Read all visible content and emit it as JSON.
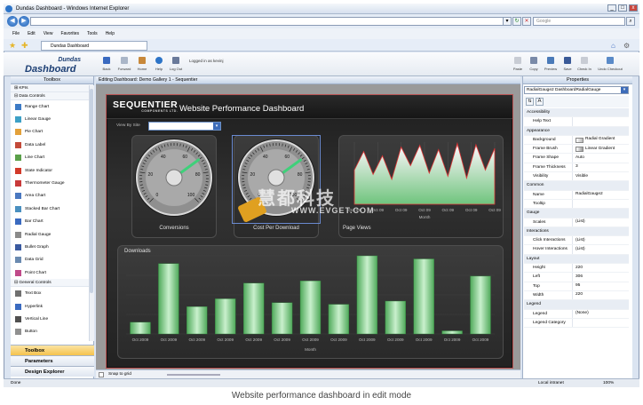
{
  "window": {
    "title": "Dundas Dashboard - Windows Internet Explorer",
    "buttons": [
      "_",
      "□",
      "x"
    ]
  },
  "browser": {
    "search_placeholder": "Google",
    "menu": [
      "File",
      "Edit",
      "View",
      "Favorites",
      "Tools",
      "Help"
    ],
    "fav_tab": "Dundas Dashboard",
    "status_left": "Done",
    "status_zone": "Local intranet",
    "zoom": "100%"
  },
  "app": {
    "logo_top": "Dundas",
    "logo_bottom": "Dashboard",
    "toolbar_left": [
      "Back",
      "Forward",
      "Home",
      "Help",
      "Log Out"
    ],
    "login_text": "Logged in as kevinj",
    "toolbar_right": [
      "Paste",
      "Copy",
      "Preview",
      "Save",
      "Check In",
      "Undo Checkout"
    ]
  },
  "toolbox": {
    "header": "Toolbox",
    "items": [
      {
        "kind": "cat",
        "label": "KPIs",
        "icon": "expand-icon"
      },
      {
        "kind": "cat",
        "label": "Data Controls",
        "icon": "collapse-icon"
      },
      {
        "kind": "item",
        "label": "Range Chart",
        "icon": "range-chart-icon",
        "color": "#3d7bc6"
      },
      {
        "kind": "item",
        "label": "Linear Gauge",
        "icon": "linear-gauge-icon",
        "color": "#3da0c6"
      },
      {
        "kind": "item",
        "label": "Pie Chart",
        "icon": "pie-chart-icon",
        "color": "#e3a13a"
      },
      {
        "kind": "item",
        "label": "Data Label",
        "icon": "data-label-icon",
        "color": "#c34a3a"
      },
      {
        "kind": "item",
        "label": "Line Chart",
        "icon": "line-chart-icon",
        "color": "#5aa04a"
      },
      {
        "kind": "item",
        "label": "State Indicator",
        "icon": "state-indicator-icon",
        "color": "#d23a2a"
      },
      {
        "kind": "item",
        "label": "Thermometer Gauge",
        "icon": "thermometer-icon",
        "color": "#c83a3a"
      },
      {
        "kind": "item",
        "label": "Area Chart",
        "icon": "area-chart-icon",
        "color": "#4a78c0"
      },
      {
        "kind": "item",
        "label": "Stacked Bar Chart",
        "icon": "stacked-bar-icon",
        "color": "#4a90c0"
      },
      {
        "kind": "item",
        "label": "Bar Chart",
        "icon": "bar-chart-icon",
        "color": "#3a6ac0"
      },
      {
        "kind": "item",
        "label": "Radial Gauge",
        "icon": "radial-gauge-icon",
        "color": "#8a8a8a"
      },
      {
        "kind": "item",
        "label": "Bullet Graph",
        "icon": "bullet-graph-icon",
        "color": "#3a5aa0"
      },
      {
        "kind": "item",
        "label": "Data Grid",
        "icon": "data-grid-icon",
        "color": "#6a8ab0"
      },
      {
        "kind": "item",
        "label": "Point Chart",
        "icon": "point-chart-icon",
        "color": "#c04a8a"
      },
      {
        "kind": "cat",
        "label": "General Controls",
        "icon": "collapse-icon"
      },
      {
        "kind": "item",
        "label": "Text Box",
        "icon": "text-box-icon",
        "color": "#707070"
      },
      {
        "kind": "item",
        "label": "Hyperlink",
        "icon": "hyperlink-icon",
        "color": "#3a6ac0"
      },
      {
        "kind": "item",
        "label": "Vertical Line",
        "icon": "vertical-line-icon",
        "color": "#505050"
      },
      {
        "kind": "item",
        "label": "Button",
        "icon": "button-icon",
        "color": "#909090"
      }
    ],
    "bottom_tabs": [
      "Toolbox",
      "Parameters",
      "Design Explorer"
    ]
  },
  "editor": {
    "header": "Editing Dashboard: Demo Gallery 1 - Sequentier",
    "snap_label": "Snap to grid"
  },
  "dashboard": {
    "brand": "SEQUENTIER",
    "brand_sub": "COMPONENTS LTD.",
    "title": "Website Performance Dashboard",
    "view_by_label": "View By Site",
    "gauges": [
      {
        "label": "Conversions",
        "value": 70,
        "max": 100,
        "ticks": [
          "0",
          "20",
          "40",
          "60",
          "80",
          "100"
        ]
      },
      {
        "label": "Cost Per Download",
        "value": 70,
        "max": 100,
        "ticks": [
          "0",
          "20",
          "40",
          "60",
          "80",
          "100"
        ]
      }
    ],
    "page_views_label": "Page Views",
    "downloads_label": "Downloads"
  },
  "chart_data": [
    {
      "type": "area",
      "title": "Page Views",
      "xlabel": "Month",
      "categories": [
        "Oct 09",
        "Oct 09",
        "Oct 09",
        "Oct 09",
        "Oct 09",
        "Oct 09",
        "Oct 09"
      ],
      "values": [
        55,
        85,
        48,
        78,
        40,
        92,
        62,
        95,
        50,
        88,
        45,
        98,
        42,
        96,
        55,
        90
      ]
    },
    {
      "type": "bar",
      "title": "Downloads",
      "xlabel": "Month",
      "categories": [
        "Oct 2009",
        "Oct 2009",
        "Oct 2009",
        "Oct 2009",
        "Oct 2009",
        "Oct 2009",
        "Oct 2009",
        "Oct 2009",
        "Oct 2009",
        "Oct 2009",
        "Oct 2009",
        "Oct 2009",
        "Oct 2009"
      ],
      "values": [
        15,
        90,
        35,
        45,
        65,
        40,
        68,
        38,
        100,
        42,
        96,
        4,
        74
      ],
      "ylim": [
        0,
        100
      ]
    }
  ],
  "properties": {
    "header": "Properties",
    "selected": "RadialGauge2  DashboardRadialGauge",
    "rows": [
      {
        "cat": "Accessibility"
      },
      {
        "k": "Help Text",
        "v": ""
      },
      {
        "cat": "Appearance"
      },
      {
        "k": "Background",
        "v": "Radial Gradient",
        "sw": "#b9b9b9"
      },
      {
        "k": "Frame Brush",
        "v": "Linear Gradient",
        "sw": "#9a9a9a"
      },
      {
        "k": "Frame Shape",
        "v": "Auto"
      },
      {
        "k": "Frame Thickness",
        "v": "3"
      },
      {
        "k": "Visibility",
        "v": "Visible"
      },
      {
        "cat": "Common"
      },
      {
        "k": "Name",
        "v": "RadialGauge2"
      },
      {
        "k": "Tooltip",
        "v": ""
      },
      {
        "cat": "Gauge"
      },
      {
        "k": "Scales",
        "v": "(List)"
      },
      {
        "cat": "Interactions"
      },
      {
        "k": "Click Interactions",
        "v": "(List)"
      },
      {
        "k": "Hover Interactions",
        "v": "(List)"
      },
      {
        "cat": "Layout"
      },
      {
        "k": "Height",
        "v": "220"
      },
      {
        "k": "Left",
        "v": "306"
      },
      {
        "k": "Top",
        "v": "95"
      },
      {
        "k": "Width",
        "v": "220"
      },
      {
        "cat": "Legend"
      },
      {
        "k": "Legend",
        "v": "(None)"
      },
      {
        "k": "Legend Category",
        "v": ""
      }
    ]
  },
  "watermark": {
    "cn": "慧都科技",
    "url": "WWW.EVGET.COM"
  },
  "caption": "Website performance dashboard in edit mode",
  "colors": {
    "bar_green": "#7fcf86",
    "accent_blue": "#2d74c7",
    "selection": "#3d6cb9"
  }
}
